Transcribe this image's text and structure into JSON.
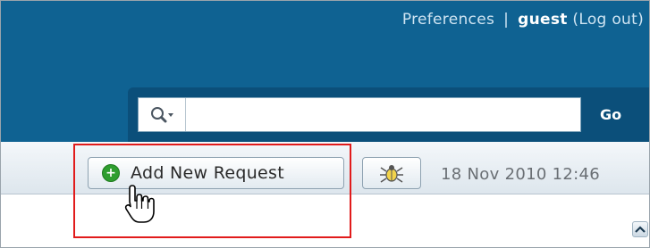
{
  "header": {
    "preferences_label": "Preferences",
    "separator": "|",
    "username": "guest",
    "logout_label": "(Log out)"
  },
  "search": {
    "value": "",
    "placeholder": "",
    "go_label": "Go"
  },
  "toolbar": {
    "add_request_label": "Add New Request",
    "timestamp": "18 Nov 2010 12:46"
  },
  "colors": {
    "header_bg": "#0f6292",
    "highlight_border": "#e11b1b",
    "add_icon": "#2f9e2f"
  },
  "icons": [
    "search-icon",
    "plus-circle-icon",
    "bug-icon",
    "hand-cursor-icon",
    "chevron-up-icon"
  ]
}
